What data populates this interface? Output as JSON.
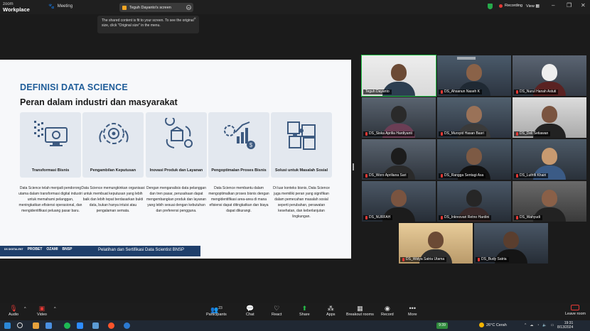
{
  "titlebar": {
    "brand_line1": "zoom",
    "brand_line2": "Workplace",
    "meeting_label": "Meeting",
    "share_label": "Teguh Dayanto's screen",
    "recording_label": "Recording",
    "view_label": "View",
    "minimize": "–",
    "restore": "❐",
    "close": "✕"
  },
  "notice": {
    "text": "The shared content is fit to your screen. To see the original size, click \"Original size\" in the menu.",
    "close": "×"
  },
  "slide": {
    "title": "DEFINISI DATA SCIENCE",
    "subtitle": "Peran dalam industri dan masyarakat",
    "cards": [
      {
        "label": "Transformasi Bisnis",
        "desc": "Data Science telah menjadi pendorong utama dalam transformasi digital industri untuk memahami pelanggan, meningkatkan efisiensi operasional, dan mengidentifikasi peluang pasar baru."
      },
      {
        "label": "Pengambilan Keputusan",
        "desc": "Data Science memungkinkan organisasi untuk membuat keputusan yang lebih baik dan lebih tepat berdasarkan bukti data, bukan hanya intuisi atau pengalaman semata."
      },
      {
        "label": "Inovasi Produk dan Layanan",
        "desc": "Dengan menganalisis data pelanggan dan tren pasar, perusahaan dapat mengembangkan produk dan layanan yang lebih sesuai dengan kebutuhan dan preferensi pengguna."
      },
      {
        "label": "Pengoptimalan Proses Bisnis",
        "desc": "Data Science membantu dalam mengoptimalkan proses bisnis dengan mengidentifikasi area-area di mana efisiensi dapat ditingkatkan dan biaya dapat dikurangi."
      },
      {
        "label": "Solusi untuk Masalah Sosial",
        "desc": "Di luar konteks bisnis, Data Science juga memiliki peran yang signifikan dalam pemecahan masalah sosial seperti perubahan, perawatan kesehatan, dan keberlanjutan lingkungan."
      }
    ],
    "footer_logos": [
      "DS DIGITALENT",
      "PROBET",
      "OZAMI",
      "BNSP"
    ],
    "footer_text": "Pelatihan dan Sertifikasi Data Scientist BNSP",
    "accent": "#1f5d99"
  },
  "gallery": {
    "participants": [
      {
        "name": "Teguh Dayanto",
        "muted": false
      },
      {
        "name": "DS_Ahsanun Naseh K",
        "muted": true
      },
      {
        "name": "DS_Nurul Hanah Astuti",
        "muted": true
      },
      {
        "name": "DS_Siska Aprilia Hardiyanti",
        "muted": true
      },
      {
        "name": "DS_Mursyid Hasan Basri",
        "muted": true
      },
      {
        "name": "DS_Deli Setiawan",
        "muted": true
      },
      {
        "name": "DS_Woro Apriliana Sari",
        "muted": true
      },
      {
        "name": "DS_Rangga Sentagi Asa",
        "muted": true
      },
      {
        "name": "DS_Luthfil Khairi",
        "muted": true
      },
      {
        "name": "DS_NURFAH",
        "muted": true
      },
      {
        "name": "DS_Inkresvari Retno Hardini",
        "muted": true
      },
      {
        "name": "DS_Wahyudi",
        "muted": true
      },
      {
        "name": "DS_Widya Satria Utama",
        "muted": true
      },
      {
        "name": "DS_Budy Satria",
        "muted": true
      }
    ]
  },
  "toolbar": {
    "audio": "Audio",
    "video": "Video",
    "participants": "Participants",
    "participants_count": "23",
    "chat": "Chat",
    "react": "React",
    "share": "Share",
    "apps": "Apps",
    "breakout": "Breakout rooms",
    "record": "Record",
    "more": "More",
    "leave": "Leave room"
  },
  "taskbar": {
    "counter": "9:39",
    "weather": "26°C  Cerah",
    "time": "19:31",
    "date": "8/13/2024"
  }
}
